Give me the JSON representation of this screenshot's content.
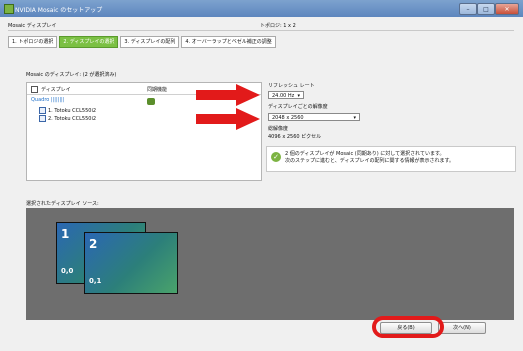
{
  "window": {
    "title": "NVIDIA Mosaic のセットアップ"
  },
  "subheader": {
    "left": "Mosaic ディスプレイ",
    "right": "トポロジ: 1 x 2"
  },
  "tabs": [
    {
      "label": "1. トポロジの選択",
      "active": false
    },
    {
      "label": "2. ディスプレイの選択",
      "active": true
    },
    {
      "label": "3. ディスプレイの配列",
      "active": false
    },
    {
      "label": "4. オーバーラップとベゼル補正の調整",
      "active": false
    }
  ],
  "displays": {
    "section_label": "Mosaic のディスプレイ: (2 が選択済み)",
    "col_display": "ディスプレイ",
    "col_sync": "同期機能",
    "gpu": "Quadro ||||||||",
    "items": [
      {
        "label": "1. Totoku CCL550i2",
        "checked": true
      },
      {
        "label": "2. Totoku CCL550i2",
        "checked": true
      }
    ]
  },
  "settings": {
    "refresh_label": "リフレッシュ レート",
    "refresh_value": "24.00 Hz",
    "resolution_label": "ディスプレイごとの解像度",
    "resolution_value": "2048 x 2560",
    "total_label": "総解像度",
    "total_value": "4096 x 2560 ピクセル"
  },
  "info": {
    "line1": "2 個のディスプレイが Mosaic (同期あり) に対して選択されています。",
    "line2": "次のステップに進むと、ディスプレイの配列に関する情報が表示されます。"
  },
  "preview": {
    "label": "選択されたディスプレイ ソース:",
    "monitors": [
      {
        "number": "1",
        "coord": "0,0"
      },
      {
        "number": "2",
        "coord": "0,1"
      }
    ]
  },
  "buttons": {
    "back": "戻る(B)",
    "next": "次へ(N)"
  },
  "colors": {
    "accent_green": "#7bc043",
    "annotation_red": "#e21a1a"
  }
}
